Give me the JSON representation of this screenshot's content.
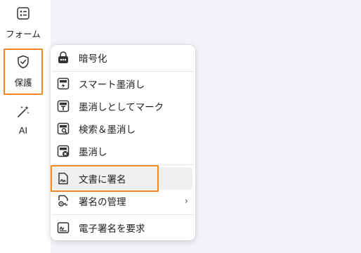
{
  "sidebar": {
    "forms": {
      "label": "フォーム",
      "icon": "form-icon"
    },
    "protect": {
      "label": "保護",
      "icon": "shield-check-icon"
    },
    "ai": {
      "label": "AI",
      "icon": "magic-wand-icon"
    }
  },
  "menu": {
    "items": [
      {
        "label": "暗号化",
        "icon": "lock-icon"
      },
      {
        "label": "スマート墨消し",
        "icon": "smart-redact-icon"
      },
      {
        "label": "墨消しとしてマーク",
        "icon": "mark-redaction-icon"
      },
      {
        "label": "検索＆墨消し",
        "icon": "search-redact-icon"
      },
      {
        "label": "墨消し",
        "icon": "redact-icon"
      },
      {
        "label": "文書に署名",
        "icon": "sign-document-icon"
      },
      {
        "label": "署名の管理",
        "icon": "manage-signatures-icon",
        "submenu": "›"
      },
      {
        "label": "電子署名を要求",
        "icon": "request-esign-icon"
      }
    ]
  },
  "colors": {
    "highlight_border": "#f08a24",
    "hover_bg": "#efeff1"
  }
}
